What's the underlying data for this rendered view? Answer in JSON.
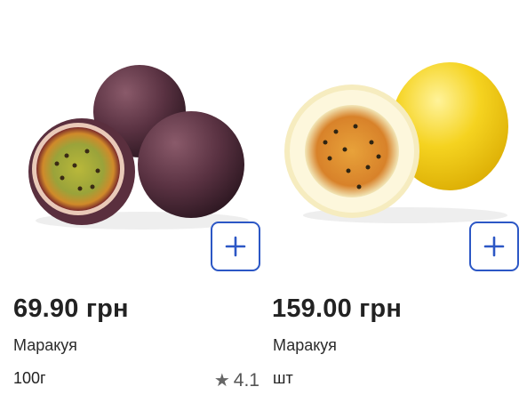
{
  "products": [
    {
      "price": "69.90 грн",
      "name": "Маракуя",
      "unit": "100г",
      "rating": "4.1",
      "image_icon": "purple-passion-fruit-image",
      "add_icon": "plus-icon"
    },
    {
      "price": "159.00 грн",
      "name": "Маракуя",
      "unit": "шт",
      "image_icon": "yellow-passion-fruit-image",
      "add_icon": "plus-icon"
    }
  ],
  "colors": {
    "accent": "#2c57c5",
    "star": "#666666"
  }
}
